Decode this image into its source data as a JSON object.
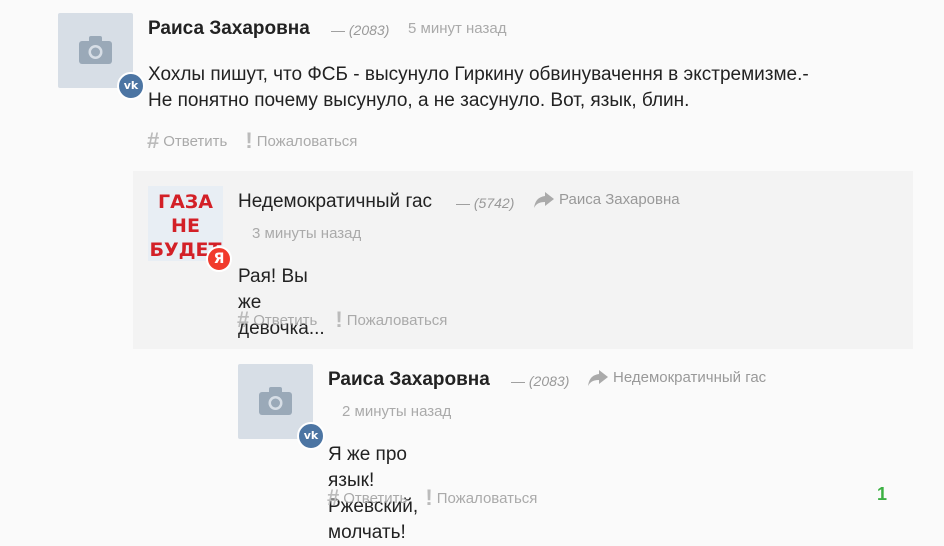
{
  "comments": [
    {
      "author": "Раиса Захаровна",
      "karma": "(2083)",
      "dash": "—",
      "time": "5 минут назад",
      "text_lines": [
        "Хохлы пишут, что ФСБ - высунуло Гиркину обвинувачення в экстремизме.-",
        "Не понятно почему высунуло, а не засунуло. Вот, язык, блин."
      ],
      "reply_label": "Ответить",
      "report_label": "Пожаловаться",
      "avatar_icon": "camera-icon",
      "badge": "vk-icon",
      "badge_text": "vk"
    },
    {
      "author": "Недемократичный гас",
      "karma": "(5742)",
      "dash": "—",
      "reply_to": "Раиса Захаровна",
      "time": "3 минуты назад",
      "text": "Рая! Вы же девочка...",
      "reply_label": "Ответить",
      "report_label": "Пожаловаться",
      "avatar_lines": [
        "ГАЗА",
        "НЕ",
        "БУДЕТ"
      ],
      "badge": "yandex-icon",
      "badge_text": "Я"
    },
    {
      "author": "Раиса Захаровна",
      "karma": "(2083)",
      "dash": "—",
      "reply_to": "Недемократичный гас",
      "time": "2 минуты назад",
      "text": "Я же про язык! Ржевский, молчать!",
      "reply_label": "Ответить",
      "report_label": "Пожаловаться",
      "avatar_icon": "camera-icon",
      "badge": "vk-icon",
      "badge_text": "vk",
      "rating": "1"
    }
  ],
  "colors": {
    "rating": "#3cb043",
    "vk": "#4c75a3",
    "yandex": "#f13b2d",
    "reply_bg": "#f3f3f3"
  }
}
